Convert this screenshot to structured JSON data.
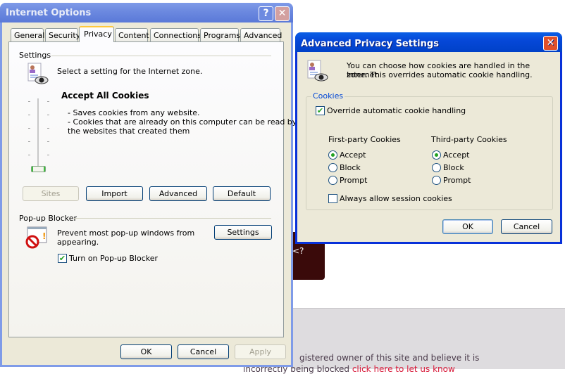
{
  "background_page": {
    "line1": "gistered owner of this site and believe it is",
    "line2_prefix": "incorrectly being blocked ",
    "link": "click here to let us know",
    "fragment": "<?"
  },
  "internet_options": {
    "title": "Internet Options",
    "help_icon": "?",
    "close_icon": "✕",
    "tabs": [
      "General",
      "Security",
      "Privacy",
      "Content",
      "Connections",
      "Programs",
      "Advanced"
    ],
    "selected_tab": "Privacy",
    "settings": {
      "group_label": "Settings",
      "intro": "Select a setting for the Internet zone.",
      "level_title": "Accept All Cookies",
      "desc1": "- Saves cookies from any website.",
      "desc2": "- Cookies that are already on this computer can be read by",
      "desc3": "the websites that created them",
      "slider_level": 0
    },
    "buttons": {
      "sites": "Sites",
      "import": "Import",
      "advanced": "Advanced",
      "default": "Default"
    },
    "popup": {
      "group_label": "Pop-up Blocker",
      "desc1": "Prevent most pop-up windows from",
      "desc2": "appearing.",
      "settings": "Settings",
      "checkbox_label": "Turn on Pop-up Blocker",
      "checked": true
    },
    "footer": {
      "ok": "OK",
      "cancel": "Cancel",
      "apply": "Apply"
    }
  },
  "advanced_privacy": {
    "title": "Advanced Privacy Settings",
    "close_icon": "✕",
    "intro1": "You can choose how cookies are handled in the Internet",
    "intro2": "zone.  This overrides automatic cookie handling.",
    "group_label": "Cookies",
    "override_label": "Override automatic cookie handling",
    "override_checked": true,
    "first_party": {
      "label": "First-party Cookies",
      "options": [
        "Accept",
        "Block",
        "Prompt"
      ],
      "selected": "Accept"
    },
    "third_party": {
      "label": "Third-party Cookies",
      "options": [
        "Accept",
        "Block",
        "Prompt"
      ],
      "selected": "Accept"
    },
    "session_label": "Always allow session cookies",
    "session_checked": false,
    "ok": "OK",
    "cancel": "Cancel"
  },
  "colors": {
    "title_active": "#0648d8",
    "title_inactive": "#7f9be8",
    "group_label_blue": "#0046d5",
    "check_green": "#21a121"
  }
}
